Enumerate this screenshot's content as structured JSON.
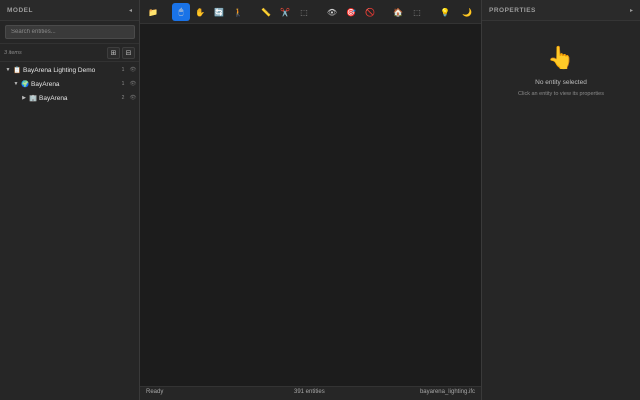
{
  "model_panel": {
    "title": "MODEL",
    "collapse_icon": "◂",
    "search_placeholder": "Search entities...",
    "count_label": "3 items",
    "expand_all_icon": "⊞",
    "collapse_all_icon": "⊟",
    "tree": [
      {
        "caret": "▼",
        "icon": "📋",
        "label": "BayArena Lighting Demo",
        "count": "1",
        "eye": "👁"
      },
      {
        "caret": "▼",
        "icon": "🌍",
        "label": "BayArena",
        "count": "1",
        "eye": "👁"
      },
      {
        "caret": "▶",
        "icon": "🏢",
        "label": "BayArena",
        "count": "2",
        "eye": "👁"
      }
    ]
  },
  "toolbar": {
    "buttons": [
      {
        "name": "folder-icon",
        "glyph": "📁"
      },
      {
        "name": "select-icon",
        "glyph": "🖱"
      },
      {
        "name": "pan-icon",
        "glyph": "✋"
      },
      {
        "name": "orbit-icon",
        "glyph": "🔄"
      },
      {
        "name": "walk-icon",
        "glyph": "🚶"
      },
      {
        "name": "measure-icon",
        "glyph": "📏"
      },
      {
        "name": "section-icon",
        "glyph": "✂️"
      },
      {
        "name": "box-select-icon",
        "glyph": "⬚"
      },
      {
        "name": "visibility-icon",
        "glyph": "👁"
      },
      {
        "name": "isolate-icon",
        "glyph": "🎯"
      },
      {
        "name": "hide-icon",
        "glyph": "🚫"
      },
      {
        "name": "home-icon",
        "glyph": "🏠"
      },
      {
        "name": "fit-icon",
        "glyph": "⬚"
      },
      {
        "name": "light-icon",
        "glyph": "💡"
      },
      {
        "name": "night-icon",
        "glyph": "🌙"
      }
    ]
  },
  "status_bar": {
    "state": "Ready",
    "entities": "391 entities",
    "file": "bayarena_lighting.ifc"
  },
  "properties_panel": {
    "title": "PROPERTIES",
    "collapse_icon": "▸",
    "pointer_icon": "👆",
    "empty_title": "No entity selected",
    "empty_hint": "Click an entity to view its properties"
  }
}
